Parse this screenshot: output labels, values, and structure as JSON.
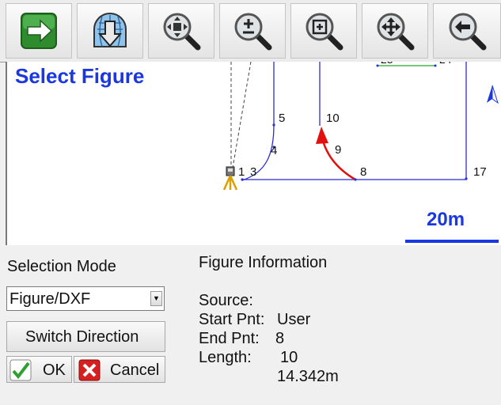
{
  "toolbar": {
    "buttons": [
      {
        "name": "forward-button",
        "icon": "green-arrow-right-icon"
      },
      {
        "name": "import-button",
        "icon": "globe-download-icon"
      },
      {
        "name": "zoom-extents-button",
        "icon": "zoom-extents-icon"
      },
      {
        "name": "zoom-in-out-button",
        "icon": "zoom-plus-minus-icon"
      },
      {
        "name": "zoom-window-button",
        "icon": "zoom-window-icon"
      },
      {
        "name": "pan-button",
        "icon": "pan-arrows-icon"
      },
      {
        "name": "zoom-previous-button",
        "icon": "zoom-back-icon"
      }
    ]
  },
  "map": {
    "title": "Select Figure",
    "scale_label": "20m",
    "point_labels": {
      "p1": "1",
      "p3": "3",
      "p4": "4",
      "p5": "5",
      "p8": "8",
      "p9": "9",
      "p10": "10",
      "p17": "17"
    },
    "colors": {
      "figure": "#2b2bd6",
      "selected": "#e01010",
      "highlight": "#22aa22",
      "title": "#1a37e0"
    }
  },
  "panel": {
    "selection_mode_label": "Selection Mode",
    "selection_mode_value": "Figure/DXF",
    "switch_direction_label": "Switch Direction",
    "ok_label": "OK",
    "cancel_label": "Cancel"
  },
  "figure_info": {
    "heading": "Figure Information",
    "source_key": "Source:",
    "source_value": "User",
    "start_key": "Start Pnt:",
    "start_value": "8",
    "end_key": "End Pnt:",
    "end_value": "10",
    "length_key": "Length:",
    "length_value": "14.342m"
  }
}
